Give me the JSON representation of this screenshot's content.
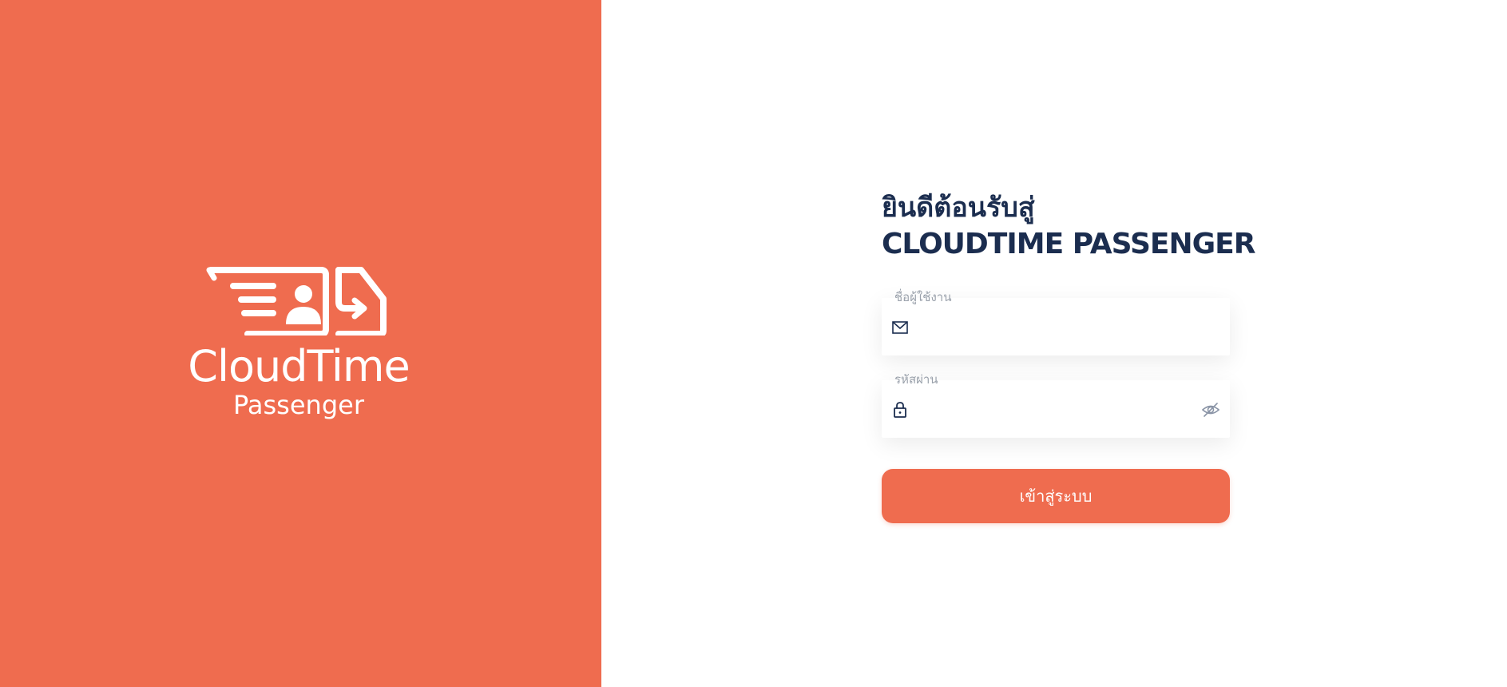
{
  "brand": {
    "name": "CloudTime",
    "sub": "Passenger",
    "color": "#EF6C4F"
  },
  "form": {
    "welcome_line1": "ยินดีต้อนรับสู่",
    "welcome_line2": "CLOUDTIME PASSENGER",
    "username": {
      "label": "ชื่อผู้ใช้งาน",
      "value": "",
      "icon": "mail-icon"
    },
    "password": {
      "label": "รหัสผ่าน",
      "value": "",
      "icon": "lock-icon",
      "toggle_icon": "eye-off-icon"
    },
    "submit_label": "เข้าสู่ระบบ"
  }
}
